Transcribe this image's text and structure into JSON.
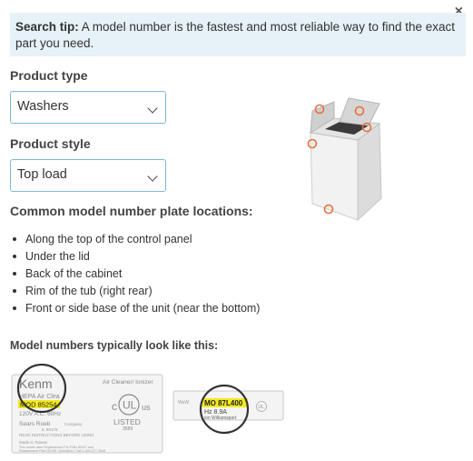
{
  "dialog": {
    "close_glyph": "×"
  },
  "tip": {
    "lead": "Search tip:",
    "text": " A model number is the fastest and most reliable way to find the exact part you need."
  },
  "product_type": {
    "label": "Product type",
    "value": "Washers"
  },
  "product_style": {
    "label": "Product style",
    "value": "Top load"
  },
  "locations": {
    "heading": "Common model number plate locations:",
    "items": [
      "Along the top of the control panel",
      "Under the lid",
      "Back of the cabinet",
      "Rim of the tub (right rear)",
      "Front or side base of the unit (near the bottom)"
    ]
  },
  "examples": {
    "heading": "Model numbers typically look like this:",
    "plate1": {
      "brand": "Kenm",
      "line1": "HEPA Air Clea",
      "model": "MOD 85254",
      "voltage": "120V A.C. 60Hz",
      "maker": "Sears Roeb",
      "product": "Air Cleaner/ Ionizer",
      "ul_c": "c",
      "ul_mark": "UL",
      "ul_us": "us",
      "listed": "LISTED",
      "listed_num": "3589",
      "company": "Company",
      "address": "IL 60179",
      "read": "READ INSTRUCTIONS BEFORE USING",
      "made": "Made in Taiwan",
      "fine1": "This model uses Replacement Pro Filter 83107 and",
      "fine2": "Replacement Filter 83195. Questions? Call 1-800-277-2818",
      "fine3": "Eastern-High Voltage"
    },
    "plate2": {
      "model": "MO 87L400",
      "rating": "Hz  8.9A",
      "city": "ion Williamsport",
      "left_text": "WeW",
      "ul_text": "UL"
    }
  },
  "colors": {
    "accent": "#e8703a",
    "tip_bg": "#e6f2f8",
    "select_border": "#7fb8d6",
    "highlight": "#f2ea1f"
  }
}
